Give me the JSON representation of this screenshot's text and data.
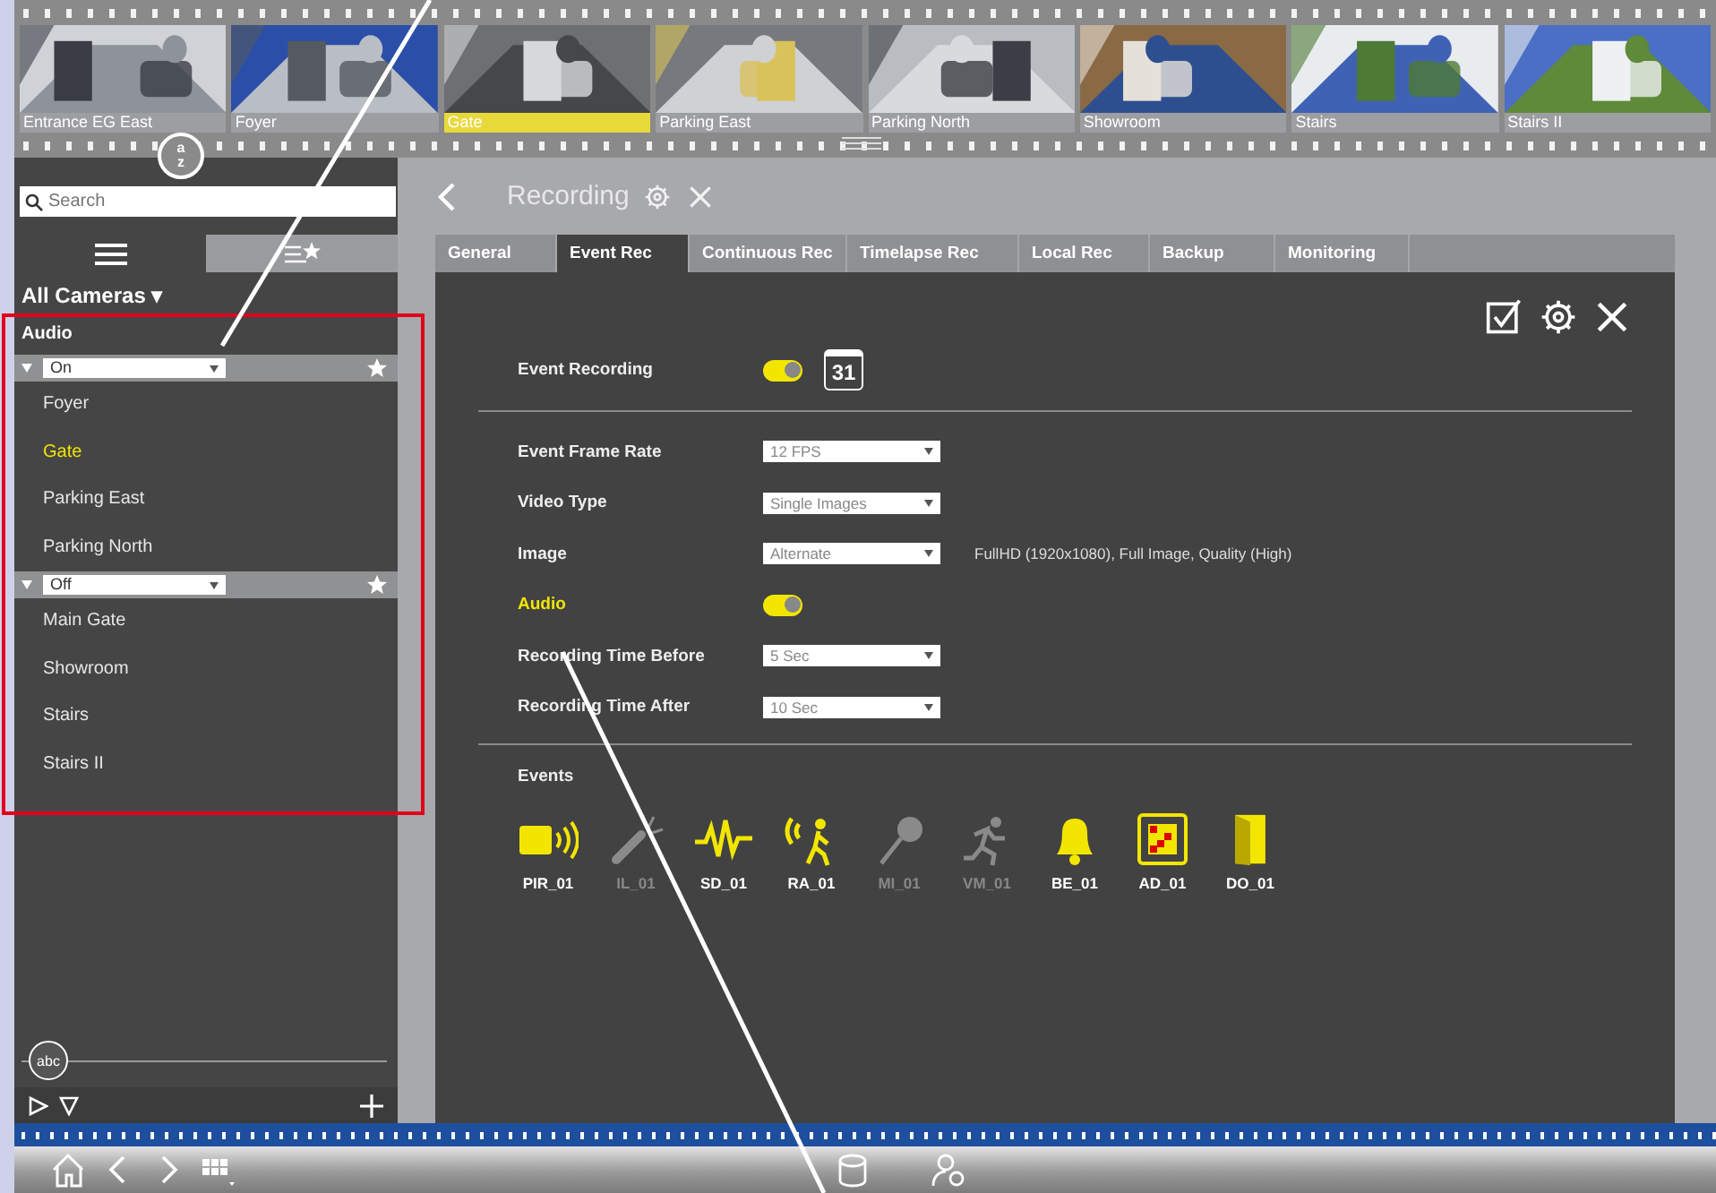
{
  "filmstrip": {
    "thumbnails": [
      {
        "label": "Entrance EG East",
        "selected": false
      },
      {
        "label": "Foyer",
        "selected": false
      },
      {
        "label": "Gate",
        "selected": true
      },
      {
        "label": "Parking East",
        "selected": false
      },
      {
        "label": "Parking North",
        "selected": false
      },
      {
        "label": "Showroom",
        "selected": false
      },
      {
        "label": "Stairs",
        "selected": false
      },
      {
        "label": "Stairs II",
        "selected": false
      }
    ],
    "sort_button": {
      "top": "a",
      "bottom": "z"
    }
  },
  "sidebar": {
    "search": {
      "placeholder": "Search"
    },
    "tabs": [
      {
        "kind": "list",
        "selected": true
      },
      {
        "kind": "favorites",
        "selected": false
      }
    ],
    "view": "All Cameras ▾",
    "section": "Audio",
    "groups": [
      {
        "filter": "On",
        "cameras": [
          {
            "label": "Foyer",
            "selected": false
          },
          {
            "label": "Gate",
            "selected": true
          },
          {
            "label": "Parking East",
            "selected": false
          },
          {
            "label": "Parking North",
            "selected": false
          }
        ]
      },
      {
        "filter": "Off",
        "cameras": [
          {
            "label": "Main Gate",
            "selected": false
          },
          {
            "label": "Showroom",
            "selected": false
          },
          {
            "label": "Stairs",
            "selected": false
          },
          {
            "label": "Stairs II",
            "selected": false
          }
        ]
      }
    ],
    "label_button": "abc"
  },
  "dialog": {
    "title": "Recording",
    "tabs": [
      {
        "label": "General",
        "selected": false
      },
      {
        "label": "Event Rec",
        "selected": true
      },
      {
        "label": "Continuous Rec",
        "selected": false
      },
      {
        "label": "Timelapse Rec",
        "selected": false
      },
      {
        "label": "Local Rec",
        "selected": false
      },
      {
        "label": "Backup",
        "selected": false
      },
      {
        "label": "Monitoring",
        "selected": false
      }
    ],
    "main_setting": {
      "label": "Event Recording",
      "on": true,
      "calendar": "31"
    },
    "settings": [
      {
        "kind": "select",
        "label": "Event Frame Rate",
        "value": "12 FPS",
        "highlighted": false
      },
      {
        "kind": "select",
        "label": "Video Type",
        "value": "Single Images",
        "highlighted": false
      },
      {
        "kind": "select",
        "label": "Image",
        "value": "Alternate",
        "note": "FullHD (1920x1080), Full Image, Quality (High)",
        "highlighted": false
      },
      {
        "kind": "toggle",
        "label": "Audio",
        "on": true,
        "highlighted": true
      },
      {
        "kind": "select",
        "label": "Recording Time Before",
        "value": "5 Sec",
        "highlighted": false
      },
      {
        "kind": "select",
        "label": "Recording Time After",
        "value": "10 Sec",
        "highlighted": false
      }
    ],
    "events_title": "Events",
    "events": [
      {
        "kind": "pir",
        "label": "PIR_01",
        "enabled": true
      },
      {
        "kind": "flashlight",
        "label": "IL_01",
        "enabled": false
      },
      {
        "kind": "sound",
        "label": "SD_01",
        "enabled": true
      },
      {
        "kind": "radar",
        "label": "RA_01",
        "enabled": true
      },
      {
        "kind": "microphone",
        "label": "MI_01",
        "enabled": false
      },
      {
        "kind": "motion",
        "label": "VM_01",
        "enabled": false
      },
      {
        "kind": "bell",
        "label": "BE_01",
        "enabled": true
      },
      {
        "kind": "alarm",
        "label": "AD_01",
        "enabled": true
      },
      {
        "kind": "door",
        "label": "DO_01",
        "enabled": true
      }
    ]
  }
}
